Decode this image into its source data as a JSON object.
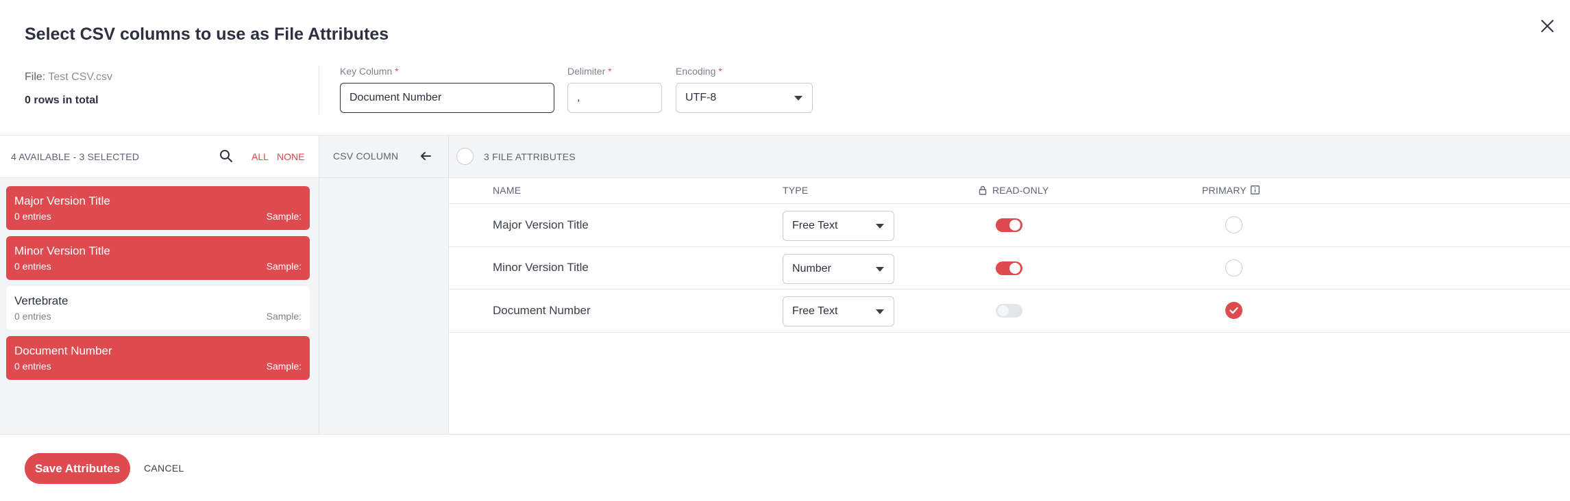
{
  "dialog": {
    "title": "Select CSV columns to use as File Attributes",
    "file_label": "File:",
    "file_name": "Test CSV.csv",
    "rows_total": "0 rows in total"
  },
  "fields": {
    "key_column": {
      "label": "Key Column",
      "required_mark": "*",
      "value": "Document Number"
    },
    "delimiter": {
      "label": "Delimiter",
      "required_mark": "*",
      "value": ","
    },
    "encoding": {
      "label": "Encoding",
      "required_mark": "*",
      "value": "UTF-8"
    }
  },
  "left_panel": {
    "summary": "4 AVAILABLE - 3 SELECTED",
    "all_label": "ALL",
    "none_label": "NONE",
    "cards": [
      {
        "name": "Major Version Title",
        "entries": "0 entries",
        "sample": "Sample:",
        "selected": true
      },
      {
        "name": "Minor Version Title",
        "entries": "0 entries",
        "sample": "Sample:",
        "selected": true
      },
      {
        "name": "Vertebrate",
        "entries": "0 entries",
        "sample": "Sample:",
        "selected": false
      },
      {
        "name": "Document Number",
        "entries": "0 entries",
        "sample": "Sample:",
        "selected": true
      }
    ]
  },
  "middle_panel": {
    "header": "CSV COLUMN"
  },
  "attributes_panel": {
    "header": "3 FILE ATTRIBUTES",
    "columns": {
      "name": "NAME",
      "type": "TYPE",
      "read_only": "READ-ONLY",
      "primary": "PRIMARY"
    },
    "rows": [
      {
        "name": "Major Version Title",
        "type": "Free Text",
        "read_only": true,
        "primary": false
      },
      {
        "name": "Minor Version Title",
        "type": "Number",
        "read_only": true,
        "primary": false
      },
      {
        "name": "Document Number",
        "type": "Free Text",
        "read_only": false,
        "primary": true
      }
    ]
  },
  "footer": {
    "save_label": "Save Attributes",
    "cancel_label": "CANCEL"
  },
  "colors": {
    "accent": "#dd4a4f",
    "panel_bg": "#f3f4f6"
  }
}
